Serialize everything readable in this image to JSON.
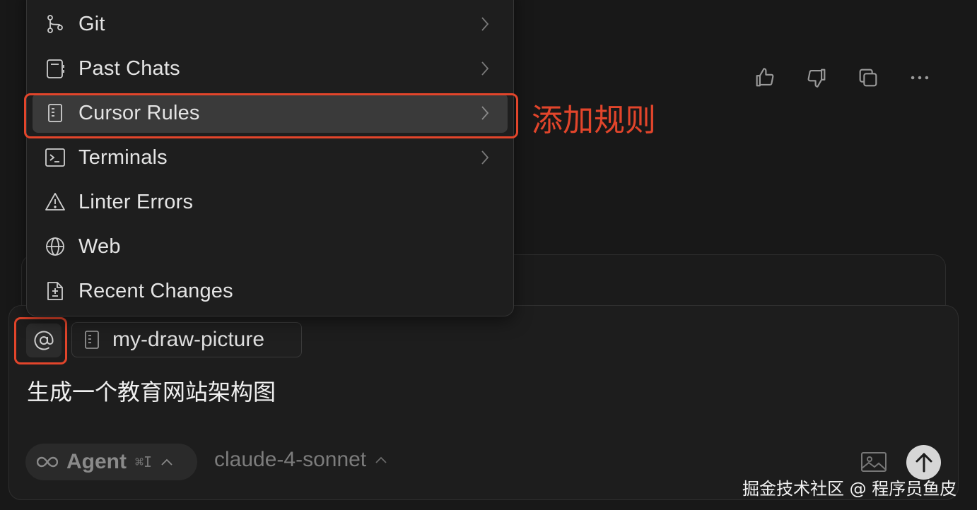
{
  "menu": {
    "items": [
      {
        "label": "Git",
        "icon": "git-branch-icon",
        "has_submenu": true
      },
      {
        "label": "Past Chats",
        "icon": "notebook-icon",
        "has_submenu": true
      },
      {
        "label": "Cursor Rules",
        "icon": "rules-file-icon",
        "has_submenu": true,
        "active": true
      },
      {
        "label": "Terminals",
        "icon": "terminal-icon",
        "has_submenu": true
      },
      {
        "label": "Linter Errors",
        "icon": "warning-icon",
        "has_submenu": false
      },
      {
        "label": "Web",
        "icon": "globe-icon",
        "has_submenu": false
      },
      {
        "label": "Recent Changes",
        "icon": "diff-file-icon",
        "has_submenu": false
      }
    ]
  },
  "annotation": {
    "text": "添加规则",
    "color": "#e2452b"
  },
  "message_actions": [
    "thumbs-up-icon",
    "thumbs-down-icon",
    "copy-icon",
    "more-icon"
  ],
  "composer": {
    "mention_button": "@",
    "context_chip": {
      "label": "my-draw-picture",
      "icon": "rules-file-icon"
    },
    "prompt": "生成一个教育网站架构图",
    "agent": {
      "label": "Agent",
      "shortcut": "⌘I"
    },
    "model": "claude-4-sonnet"
  },
  "watermark": "掘金技术社区 @ 程序员鱼皮",
  "colors": {
    "background": "#181818",
    "accent": "#e2452b",
    "active_item": "#3a3a3a"
  }
}
